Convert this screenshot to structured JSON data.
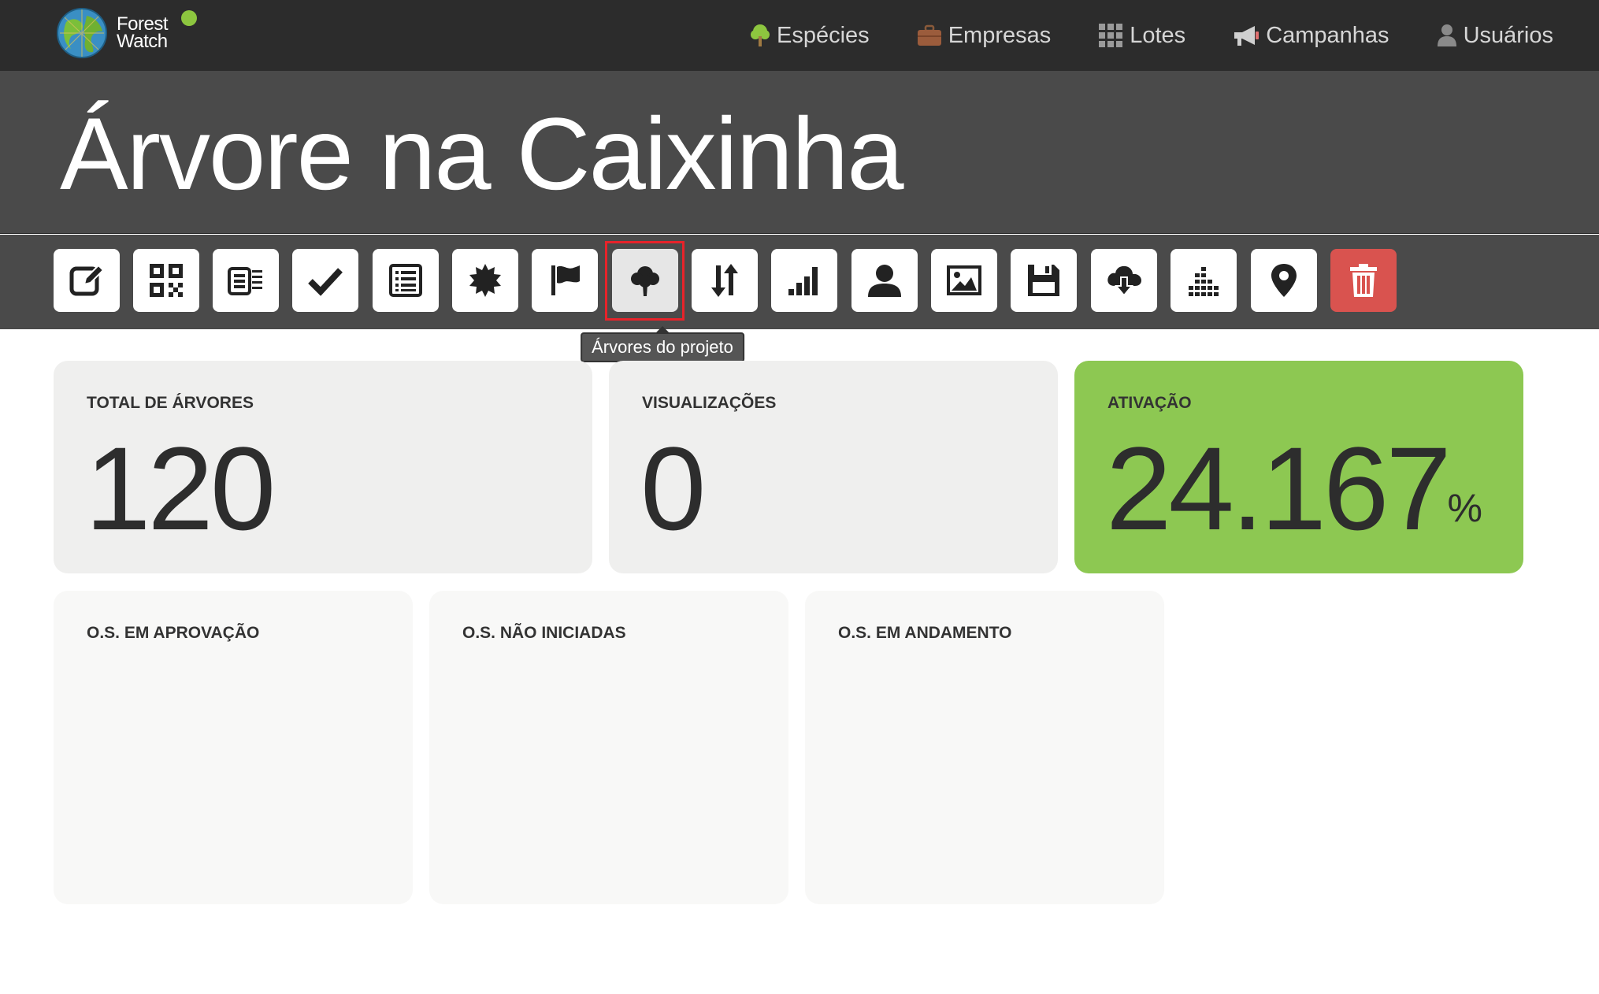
{
  "brand": {
    "line1": "Forest",
    "line2": "Watch",
    "accent": "#8dc63f"
  },
  "nav": [
    {
      "label": "Espécies",
      "icon": "tree-icon"
    },
    {
      "label": "Empresas",
      "icon": "briefcase-icon"
    },
    {
      "label": "Lotes",
      "icon": "grid-icon"
    },
    {
      "label": "Campanhas",
      "icon": "megaphone-icon"
    },
    {
      "label": "Usuários",
      "icon": "user-icon"
    }
  ],
  "page": {
    "title": "Árvore na Caixinha"
  },
  "toolbar": {
    "buttons": [
      {
        "icon": "edit-icon",
        "state": "default"
      },
      {
        "icon": "qr-code-icon",
        "state": "default"
      },
      {
        "icon": "barcode-list-icon",
        "state": "default"
      },
      {
        "icon": "check-icon",
        "state": "default"
      },
      {
        "icon": "list-icon",
        "state": "default"
      },
      {
        "icon": "certificate-icon",
        "state": "default"
      },
      {
        "icon": "flag-icon",
        "state": "default"
      },
      {
        "icon": "tree-icon",
        "state": "active"
      },
      {
        "icon": "sort-arrows-icon",
        "state": "default"
      },
      {
        "icon": "signal-bars-icon",
        "state": "default"
      },
      {
        "icon": "user-icon",
        "state": "default"
      },
      {
        "icon": "image-icon",
        "state": "default"
      },
      {
        "icon": "save-icon",
        "state": "default"
      },
      {
        "icon": "cloud-download-icon",
        "state": "default"
      },
      {
        "icon": "stacked-chart-icon",
        "state": "default"
      },
      {
        "icon": "map-marker-icon",
        "state": "default"
      },
      {
        "icon": "trash-icon",
        "state": "danger"
      }
    ],
    "tooltip": "Árvores do projeto"
  },
  "stats": {
    "total": {
      "label": "TOTAL DE ÁRVORES",
      "value": "120"
    },
    "views": {
      "label": "VISUALIZAÇÕES",
      "value": "0"
    },
    "activation": {
      "label": "ATIVAÇÃO",
      "value": "24.167",
      "unit": "%"
    }
  },
  "orders": {
    "approval": {
      "label": "O.S. EM APROVAÇÃO"
    },
    "not_started": {
      "label": "O.S. NÃO INICIADAS"
    },
    "in_progress": {
      "label": "O.S. EM ANDAMENTO"
    }
  },
  "colors": {
    "activation_card": "#8dc852",
    "danger": "#d9534f",
    "highlight": "#e8232a"
  }
}
